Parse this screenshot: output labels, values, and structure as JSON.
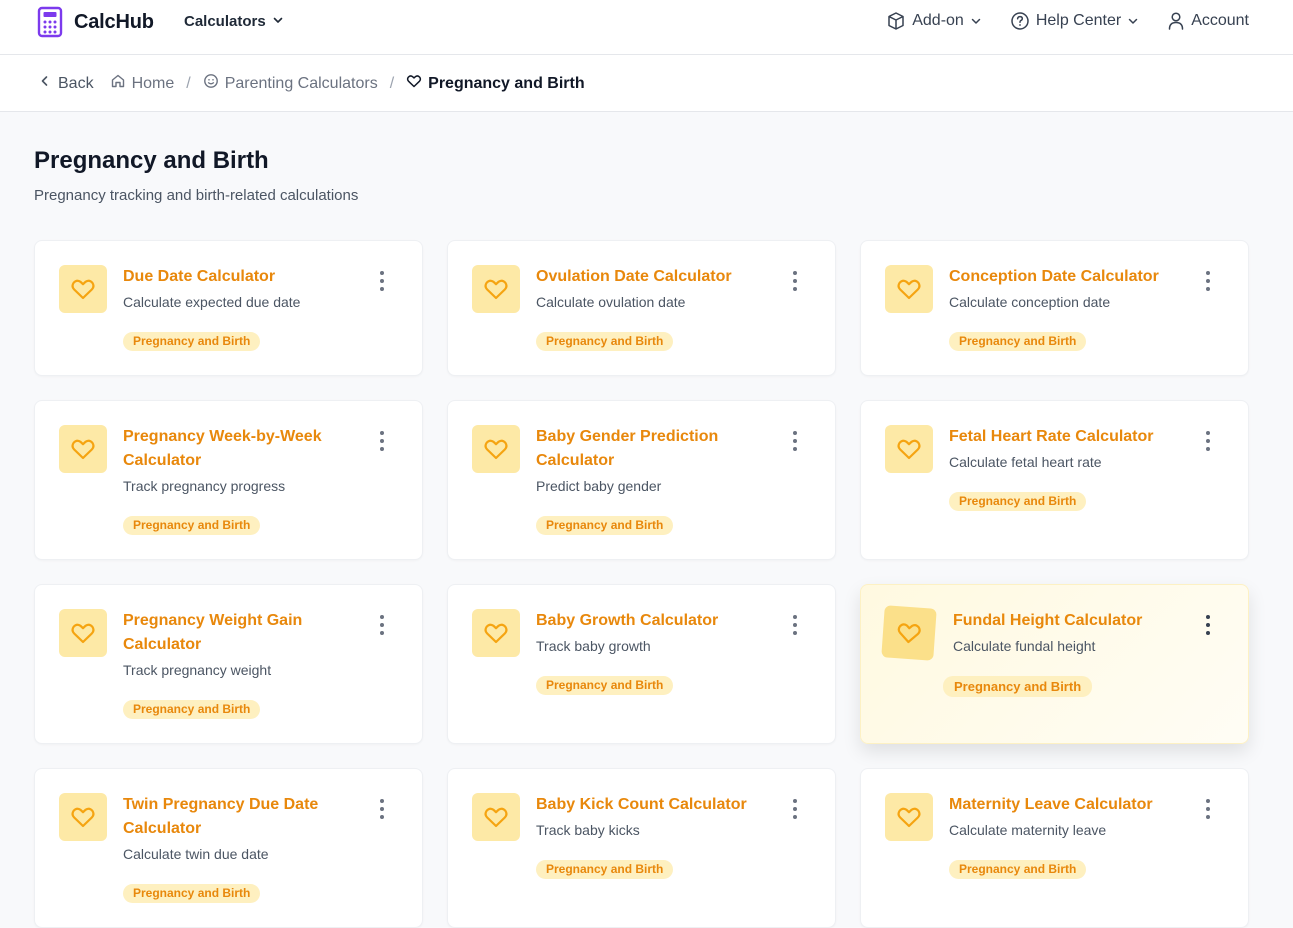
{
  "app": {
    "name": "CalcHub"
  },
  "nav": {
    "calculators_label": "Calculators",
    "addon_label": "Add-on",
    "help_label": "Help Center",
    "account_label": "Account"
  },
  "breadcrumb": {
    "back": "Back",
    "home": "Home",
    "parent": "Parenting Calculators",
    "current": "Pregnancy and Birth",
    "separator": "/"
  },
  "page": {
    "title": "Pregnancy and Birth",
    "subtitle": "Pregnancy tracking and birth-related calculations"
  },
  "colors": {
    "accent": "#e8880c",
    "icon_bg": "#fde9a6",
    "tag_bg": "#fef0c0",
    "logo": "#7c3aed"
  },
  "cards": [
    {
      "title": "Due Date Calculator",
      "desc": "Calculate expected due date",
      "tag": "Pregnancy and Birth",
      "icon": "heart-icon"
    },
    {
      "title": "Ovulation Date Calculator",
      "desc": "Calculate ovulation date",
      "tag": "Pregnancy and Birth",
      "icon": "heart-icon"
    },
    {
      "title": "Conception Date Calculator",
      "desc": "Calculate conception date",
      "tag": "Pregnancy and Birth",
      "icon": "heart-icon"
    },
    {
      "title": "Pregnancy Week-by-Week Calculator",
      "desc": "Track pregnancy progress",
      "tag": "Pregnancy and Birth",
      "icon": "heart-icon"
    },
    {
      "title": "Baby Gender Prediction Calculator",
      "desc": "Predict baby gender",
      "tag": "Pregnancy and Birth",
      "icon": "heart-icon"
    },
    {
      "title": "Fetal Heart Rate Calculator",
      "desc": "Calculate fetal heart rate",
      "tag": "Pregnancy and Birth",
      "icon": "heart-icon"
    },
    {
      "title": "Pregnancy Weight Gain Calculator",
      "desc": "Track pregnancy weight",
      "tag": "Pregnancy and Birth",
      "icon": "heart-icon"
    },
    {
      "title": "Baby Growth Calculator",
      "desc": "Track baby growth",
      "tag": "Pregnancy and Birth",
      "icon": "heart-icon"
    },
    {
      "title": "Fundal Height Calculator",
      "desc": "Calculate fundal height",
      "tag": "Pregnancy and Birth",
      "icon": "heart-icon",
      "hovered": true
    },
    {
      "title": "Twin Pregnancy Due Date Calculator",
      "desc": "Calculate twin due date",
      "tag": "Pregnancy and Birth",
      "icon": "heart-icon"
    },
    {
      "title": "Baby Kick Count Calculator",
      "desc": "Track baby kicks",
      "tag": "Pregnancy and Birth",
      "icon": "heart-icon"
    },
    {
      "title": "Maternity Leave Calculator",
      "desc": "Calculate maternity leave",
      "tag": "Pregnancy and Birth",
      "icon": "heart-icon"
    }
  ]
}
